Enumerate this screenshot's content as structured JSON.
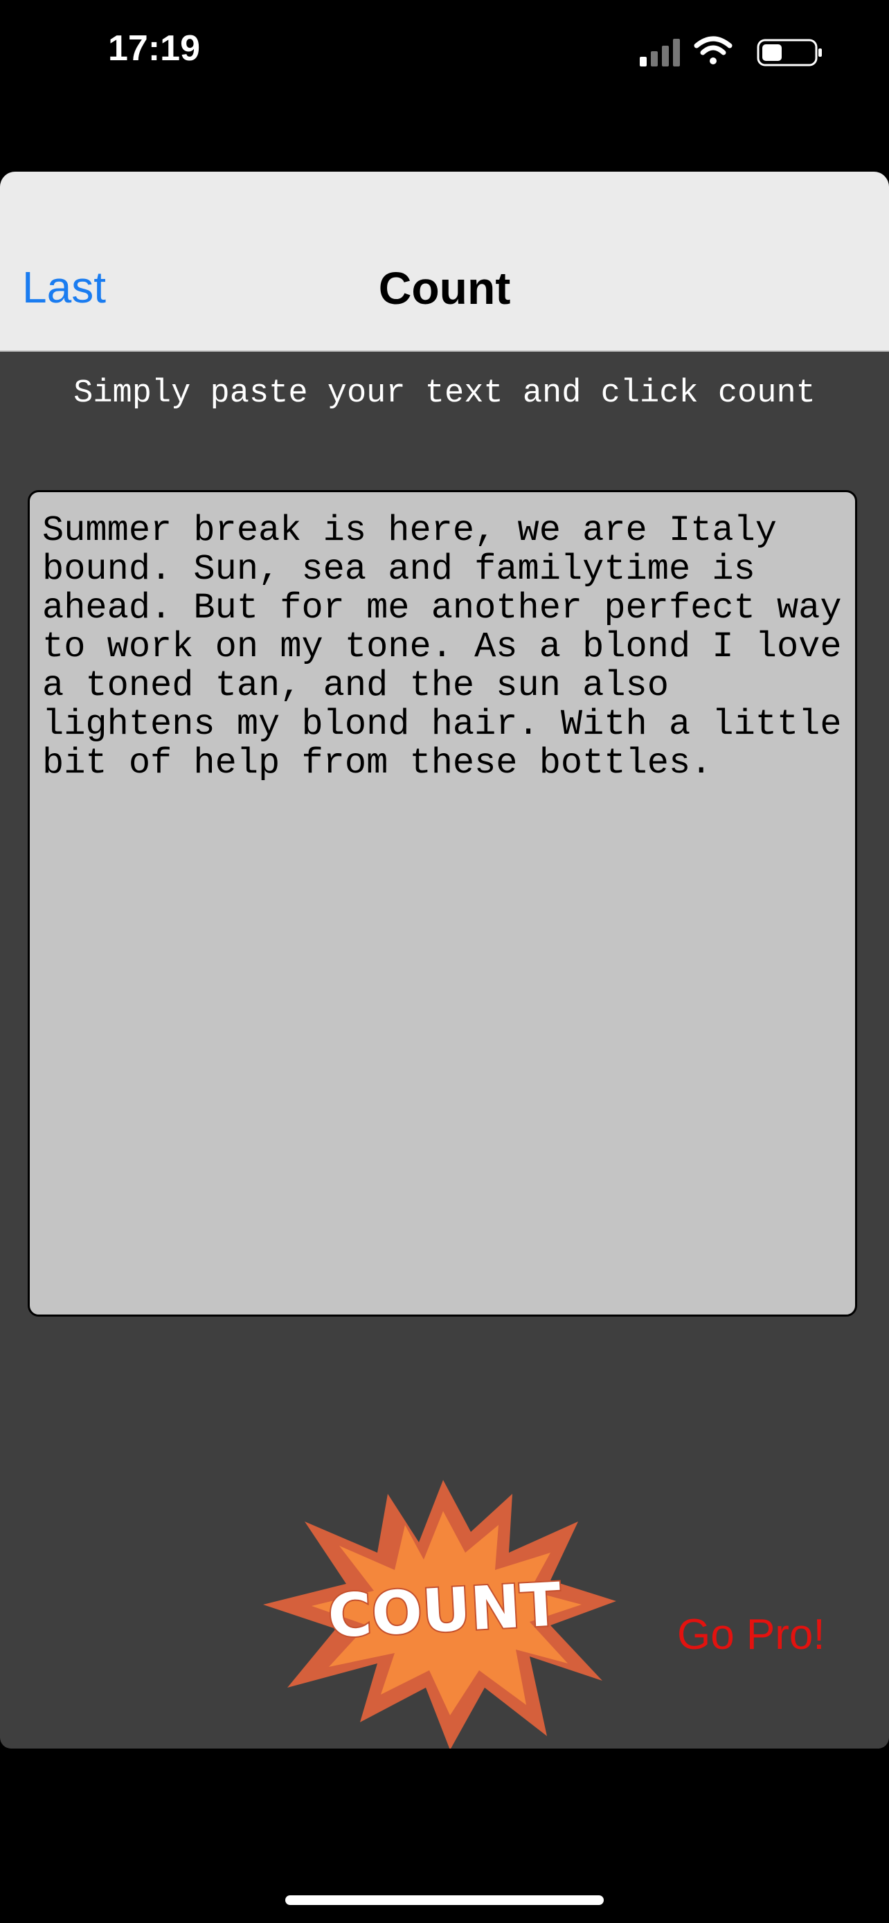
{
  "status_bar": {
    "time": "17:19",
    "icons": [
      "signal-icon",
      "wifi-icon",
      "battery-icon"
    ]
  },
  "navbar": {
    "back_label": "Last",
    "title": "Count"
  },
  "instructions": "Simply paste your text and click count",
  "text_area": {
    "value": "Summer break is here, we are Italy bound. Sun, sea and familytime is ahead. But for me another perfect way to work on my tone. As a blond I love a toned tan, and the sun also lightens my blond hair. With a little bit of help from these bottles."
  },
  "count_button": {
    "label": "COUNT"
  },
  "go_pro_label": "Go Pro!",
  "colors": {
    "background": "#3f3f3f",
    "navbar": "#ebebeb",
    "link": "#1a7cf0",
    "text_area": "#c4c4c4",
    "burst_outer": "#d5603c",
    "burst_inner": "#f4873c",
    "go_pro": "#e3120f"
  }
}
